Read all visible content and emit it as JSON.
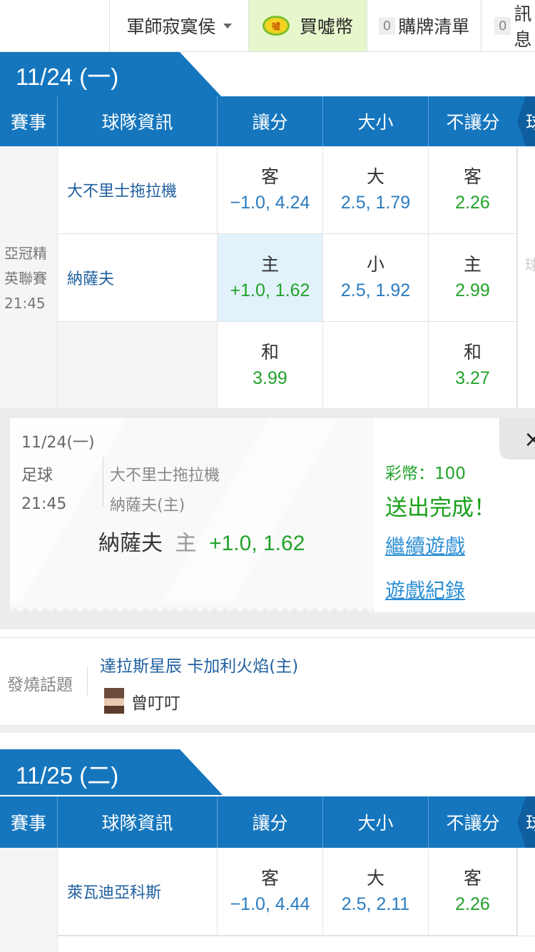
{
  "topnav": {
    "user": "軍師寂寞侯",
    "buy": {
      "icon_text": "噓",
      "label": "買噓幣"
    },
    "bet_list": {
      "count": "0",
      "label": "購牌清單"
    },
    "messages": {
      "count": "0",
      "label": "訊息"
    }
  },
  "headers": [
    "賽事",
    "球隊資訊",
    "讓分",
    "大小",
    "不讓分",
    "球"
  ],
  "day1": {
    "date": "11/24 (一)",
    "league": "亞冠精英聯賽",
    "time": "21:45",
    "rows": [
      {
        "team": "大不里士拖拉機",
        "spread": {
          "label": "客",
          "value": "−1.0, 4.24"
        },
        "total": {
          "label": "大",
          "value": "2.5, 1.79"
        },
        "ml": {
          "label": "客",
          "value": "2.26"
        }
      },
      {
        "team": "納薩夫",
        "spread": {
          "label": "主",
          "value": "+1.0, 1.62"
        },
        "total": {
          "label": "小",
          "value": "2.5, 1.92"
        },
        "ml": {
          "label": "主",
          "value": "2.99"
        }
      },
      {
        "team": "",
        "spread": {
          "label": "和",
          "value": "3.99"
        },
        "total": {
          "label": "",
          "value": ""
        },
        "ml": {
          "label": "和",
          "value": "3.27"
        }
      }
    ],
    "right_stub": "球"
  },
  "ticket": {
    "date": "11/24(一)",
    "sport": "足球",
    "time": "21:45",
    "away": "大不里士拖拉機",
    "home": "納薩夫(主)",
    "pick_team": "納薩夫",
    "pick_side": "主",
    "pick_odds": "+1.0, 1.62",
    "coins": "彩幣：100",
    "status": "送出完成！",
    "continue_link": "繼續遊戲",
    "history_link": "遊戲紀錄",
    "close": "×"
  },
  "hot": {
    "label": "發燒話題",
    "title": "達拉斯星辰 卡加利火焰(主)",
    "author": "曾叮叮"
  },
  "day2": {
    "date": "11/25 (二)",
    "rows": [
      {
        "team": "萊瓦迪亞科斯",
        "spread": {
          "label": "客",
          "value": "−1.0, 4.44"
        },
        "total": {
          "label": "大",
          "value": "2.5, 2.11"
        },
        "ml": {
          "label": "客",
          "value": "2.26"
        }
      }
    ]
  }
}
